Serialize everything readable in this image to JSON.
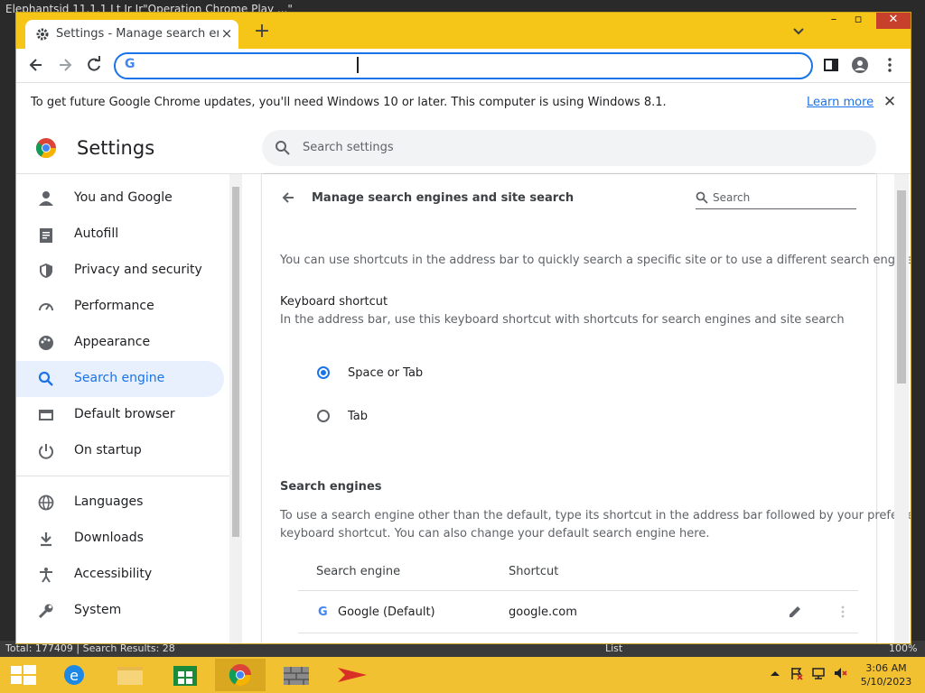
{
  "background": {
    "title_fragment": "Elephantsid 11.1.1 Lt Jr Jr\"Operation Chrome Play ...\"",
    "status_left": "Total: 177409  |  Search Results: 28",
    "status_list": "List",
    "status_zoom": "100%"
  },
  "browser": {
    "tab_title": "Settings - Manage search engines",
    "tab_close": "×",
    "new_tab": "+",
    "omnibox": {
      "value": "",
      "g_label": "G"
    },
    "colors": {
      "titlebar": "#f5c518",
      "accent": "#1a73e8"
    }
  },
  "infobar": {
    "message": "To get future Google Chrome updates, you'll need Windows 10 or later. This computer is using Windows 8.1.",
    "link": "Learn more",
    "close": "✕"
  },
  "settings": {
    "title": "Settings",
    "search_placeholder": "Search settings",
    "nav": [
      {
        "label": "You and Google",
        "icon": "person-icon"
      },
      {
        "label": "Autofill",
        "icon": "clipboard-icon"
      },
      {
        "label": "Privacy and security",
        "icon": "shield-icon"
      },
      {
        "label": "Performance",
        "icon": "speedometer-icon"
      },
      {
        "label": "Appearance",
        "icon": "palette-icon"
      },
      {
        "label": "Search engine",
        "icon": "search-icon",
        "active": true
      },
      {
        "label": "Default browser",
        "icon": "browser-icon"
      },
      {
        "label": "On startup",
        "icon": "power-icon"
      },
      {
        "label": "Languages",
        "icon": "globe-icon"
      },
      {
        "label": "Downloads",
        "icon": "download-icon"
      },
      {
        "label": "Accessibility",
        "icon": "accessibility-icon"
      },
      {
        "label": "System",
        "icon": "wrench-icon"
      }
    ]
  },
  "page": {
    "title": "Manage search engines and site search",
    "search_placeholder": "Search",
    "intro": "You can use shortcuts in the address bar to quickly search a specific site or to use a different search engine",
    "shortcut_heading": "Keyboard shortcut",
    "shortcut_desc": "In the address bar, use this keyboard shortcut with shortcuts for search engines and site search",
    "options": [
      {
        "label": "Space or Tab",
        "checked": true
      },
      {
        "label": "Tab",
        "checked": false
      }
    ],
    "engines_heading": "Search engines",
    "engines_desc_1": "To use a search engine other than the default, type its shortcut in the address bar followed by your preferred",
    "engines_desc_2": "keyboard shortcut. You can also change your default search engine here.",
    "table": {
      "col_engine": "Search engine",
      "col_shortcut": "Shortcut",
      "rows": [
        {
          "name": "Google (Default)",
          "shortcut": "google.com"
        }
      ]
    }
  },
  "taskbar": {
    "time": "3:06 AM",
    "date": "5/10/2023"
  }
}
